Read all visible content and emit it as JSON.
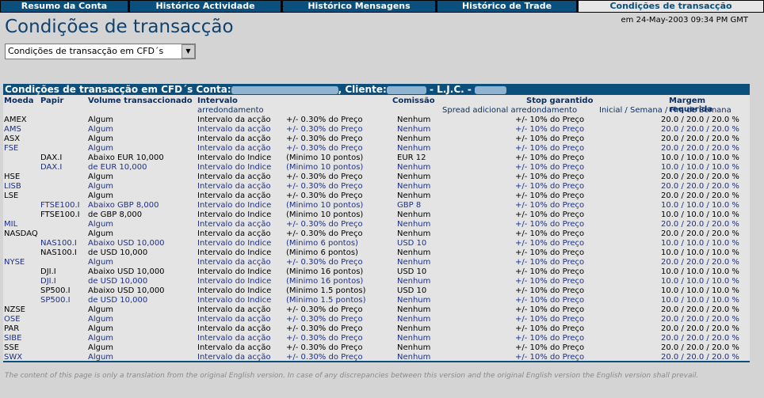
{
  "tabs": [
    "Resumo da Conta",
    "Histórico Actividade",
    "Histórico Mensagens",
    "Histórico de Trade",
    "Condições de transacção"
  ],
  "timestamp": "em 24-May-2003 09:34 PM GMT",
  "page_title": "Condições de transacção",
  "select": {
    "value": "Condições de transacção em CFD´s"
  },
  "table": {
    "bar": {
      "prefix": "Condições de transacção em CFD´s  Conta:",
      "cliente": ", Cliente:",
      "ljc": " - L.J.C. - "
    },
    "headers": {
      "moeda": "Moeda",
      "papir": "Papir",
      "volume": "Volume transaccionado",
      "intervalo": "Intervalo",
      "arredondamento": "arredondamento",
      "comissao": "Comissão",
      "stop": "Stop garantido",
      "spread": "Spread adicional arredondamento",
      "margem": "Margem requerida",
      "margem_sub": "Inicial / Semana / Fim de Semana"
    },
    "rows": [
      {
        "moeda": "AMEX",
        "papir": "",
        "volume": "Algum",
        "intervalo": "Intervalo da acção",
        "arr": "+/- 0.30% do Preço",
        "com": "Nenhum",
        "stop": "+/- 10% do Preço",
        "margem": "20.0 / 20.0 / 20.0 %"
      },
      {
        "moeda": "AMS",
        "papir": "",
        "volume": "Algum",
        "intervalo": "Intervalo da acção",
        "arr": "+/- 0.30% do Preço",
        "com": "Nenhum",
        "stop": "+/- 10% do Preço",
        "margem": "20.0 / 20.0 / 20.0 %"
      },
      {
        "moeda": "ASX",
        "papir": "",
        "volume": "Algum",
        "intervalo": "Intervalo da acção",
        "arr": "+/- 0.30% do Preço",
        "com": "Nenhum",
        "stop": "+/- 10% do Preço",
        "margem": "20.0 / 20.0 / 20.0 %"
      },
      {
        "moeda": "FSE",
        "papir": "",
        "volume": "Algum",
        "intervalo": "Intervalo da acção",
        "arr": "+/- 0.30% do Preço",
        "com": "Nenhum",
        "stop": "+/- 10% do Preço",
        "margem": "20.0 / 20.0 / 20.0 %"
      },
      {
        "moeda": "",
        "papir": "DAX.I",
        "volume": "Abaixo EUR 10,000",
        "intervalo": "Intervalo do Indice",
        "arr": "(Minimo 10  pontos)",
        "com": "EUR 12",
        "stop": "+/- 10% do Preço",
        "margem": "10.0 / 10.0 / 10.0 %"
      },
      {
        "moeda": "",
        "papir": "DAX.I",
        "volume": "de EUR 10,000",
        "intervalo": "Intervalo do Indice",
        "arr": "(Minimo 10  pontos)",
        "com": "Nenhum",
        "stop": "+/- 10% do Preço",
        "margem": "10.0 / 10.0 / 10.0 %"
      },
      {
        "moeda": "HSE",
        "papir": "",
        "volume": "Algum",
        "intervalo": "Intervalo da acção",
        "arr": "+/- 0.30% do Preço",
        "com": "Nenhum",
        "stop": "+/- 10% do Preço",
        "margem": "20.0 / 20.0 / 20.0 %"
      },
      {
        "moeda": "LISB",
        "papir": "",
        "volume": "Algum",
        "intervalo": "Intervalo da acção",
        "arr": "+/- 0.30% do Preço",
        "com": "Nenhum",
        "stop": "+/- 10% do Preço",
        "margem": "20.0 / 20.0 / 20.0 %"
      },
      {
        "moeda": "LSE",
        "papir": "",
        "volume": "Algum",
        "intervalo": "Intervalo da acção",
        "arr": "+/- 0.30% do Preço",
        "com": "Nenhum",
        "stop": "+/- 10% do Preço",
        "margem": "20.0 / 20.0 / 20.0 %"
      },
      {
        "moeda": "",
        "papir": "FTSE100.I",
        "volume": "Abaixo GBP 8,000",
        "intervalo": "Intervalo do Indice",
        "arr": "(Minimo 10  pontos)",
        "com": "GBP 8",
        "stop": "+/- 10% do Preço",
        "margem": "10.0 / 10.0 / 10.0 %"
      },
      {
        "moeda": "",
        "papir": "FTSE100.I",
        "volume": "de GBP 8,000",
        "intervalo": "Intervalo do Indice",
        "arr": "(Minimo 10  pontos)",
        "com": "Nenhum",
        "stop": "+/- 10% do Preço",
        "margem": "10.0 / 10.0 / 10.0 %"
      },
      {
        "moeda": "MIL",
        "papir": "",
        "volume": "Algum",
        "intervalo": "Intervalo da acção",
        "arr": "+/- 0.30% do Preço",
        "com": "Nenhum",
        "stop": "+/- 10% do Preço",
        "margem": "20.0 / 20.0 / 20.0 %"
      },
      {
        "moeda": "NASDAQ",
        "papir": "",
        "volume": "Algum",
        "intervalo": "Intervalo da acção",
        "arr": "+/- 0.30% do Preço",
        "com": "Nenhum",
        "stop": "+/- 10% do Preço",
        "margem": "20.0 / 20.0 / 20.0 %"
      },
      {
        "moeda": "",
        "papir": "NAS100.I",
        "volume": "Abaixo USD 10,000",
        "intervalo": "Intervalo do Indice",
        "arr": "(Minimo 6  pontos)",
        "com": "USD 10",
        "stop": "+/- 10% do Preço",
        "margem": "10.0 / 10.0 / 10.0 %"
      },
      {
        "moeda": "",
        "papir": "NAS100.I",
        "volume": "de USD 10,000",
        "intervalo": "Intervalo do Indice",
        "arr": "(Minimo 6  pontos)",
        "com": "Nenhum",
        "stop": "+/- 10% do Preço",
        "margem": "10.0 / 10.0 / 10.0 %"
      },
      {
        "moeda": "NYSE",
        "papir": "",
        "volume": "Algum",
        "intervalo": "Intervalo da acção",
        "arr": "+/- 0.30% do Preço",
        "com": "Nenhum",
        "stop": "+/- 10% do Preço",
        "margem": "20.0 / 20.0 / 20.0 %"
      },
      {
        "moeda": "",
        "papir": "DJI.I",
        "volume": "Abaixo USD 10,000",
        "intervalo": "Intervalo do Indice",
        "arr": "(Minimo 16  pontos)",
        "com": "USD 10",
        "stop": "+/- 10% do Preço",
        "margem": "10.0 / 10.0 / 10.0 %"
      },
      {
        "moeda": "",
        "papir": "DJI.I",
        "volume": "de USD 10,000",
        "intervalo": "Intervalo do Indice",
        "arr": "(Minimo 16  pontos)",
        "com": "Nenhum",
        "stop": "+/- 10% do Preço",
        "margem": "10.0 / 10.0 / 10.0 %"
      },
      {
        "moeda": "",
        "papir": "SP500.I",
        "volume": "Abaixo USD 10,000",
        "intervalo": "Intervalo do Indice",
        "arr": "(Minimo 1.5  pontos)",
        "com": "USD 10",
        "stop": "+/- 10% do Preço",
        "margem": "10.0 / 10.0 / 10.0 %"
      },
      {
        "moeda": "",
        "papir": "SP500.I",
        "volume": "de USD 10,000",
        "intervalo": "Intervalo do Indice",
        "arr": "(Minimo 1.5  pontos)",
        "com": "Nenhum",
        "stop": "+/- 10% do Preço",
        "margem": "10.0 / 10.0 / 10.0 %"
      },
      {
        "moeda": "NZSE",
        "papir": "",
        "volume": "Algum",
        "intervalo": "Intervalo da acção",
        "arr": "+/- 0.30% do Preço",
        "com": "Nenhum",
        "stop": "+/- 10% do Preço",
        "margem": "20.0 / 20.0 / 20.0 %"
      },
      {
        "moeda": "OSE",
        "papir": "",
        "volume": "Algum",
        "intervalo": "Intervalo da acção",
        "arr": "+/- 0.30% do Preço",
        "com": "Nenhum",
        "stop": "+/- 10% do Preço",
        "margem": "20.0 / 20.0 / 20.0 %"
      },
      {
        "moeda": "PAR",
        "papir": "",
        "volume": "Algum",
        "intervalo": "Intervalo da acção",
        "arr": "+/- 0.30% do Preço",
        "com": "Nenhum",
        "stop": "+/- 10% do Preço",
        "margem": "20.0 / 20.0 / 20.0 %"
      },
      {
        "moeda": "SIBE",
        "papir": "",
        "volume": "Algum",
        "intervalo": "Intervalo da acção",
        "arr": "+/- 0.30% do Preço",
        "com": "Nenhum",
        "stop": "+/- 10% do Preço",
        "margem": "20.0 / 20.0 / 20.0 %"
      },
      {
        "moeda": "SSE",
        "papir": "",
        "volume": "Algum",
        "intervalo": "Intervalo da acção",
        "arr": "+/- 0.30% do Preço",
        "com": "Nenhum",
        "stop": "+/- 10% do Preço",
        "margem": "20.0 / 20.0 / 20.0 %"
      },
      {
        "moeda": "SWX",
        "papir": "",
        "volume": "Algum",
        "intervalo": "Intervalo da acção",
        "arr": "+/- 0.30% do Preço",
        "com": "Nenhum",
        "stop": "+/- 10% do Preço",
        "margem": "20.0 / 20.0 / 20.0 %"
      }
    ]
  },
  "footer": "The content of this page is only a translation from the original English version. In case of any discrepancies between this version and the original English version the English version shall prevail."
}
